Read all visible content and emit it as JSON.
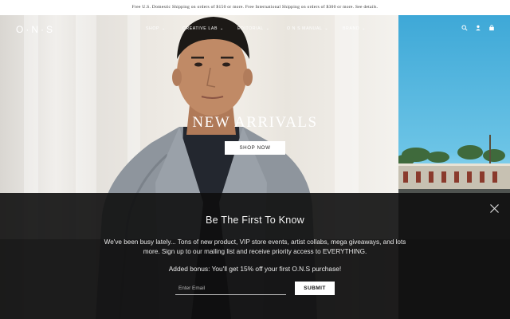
{
  "announcement": "Free U.S. Domestic Shipping on orders of $150 or more. Free International Shipping on orders of $300 or more. See details.",
  "logo": "O·N·S",
  "nav": {
    "items": [
      {
        "label": "SHOP"
      },
      {
        "label": "CREATIVE LAB"
      },
      {
        "label": "EDITORIAL"
      },
      {
        "label": "O N S MANUAL"
      },
      {
        "label": "BRAND"
      }
    ],
    "utility_icons": [
      "search-icon",
      "user-icon",
      "cart-icon"
    ]
  },
  "hero": {
    "title": "NEW ARRIVALS",
    "cta": "SHOP NOW"
  },
  "popup": {
    "title": "Be The First To Know",
    "body": "We've been busy lately... Tons of new product, VIP store events, artist collabs, mega giveaways, and lots more. Sign up to our mailing list and receive priority access to EVERYTHING.",
    "bonus": "Added bonus: You'll get 15% off your first O.N.S purchase!",
    "email_placeholder": "Enter Email",
    "submit": "SUBMIT"
  },
  "colors": {
    "popup_bg": "#0e0e0e",
    "text_light": "#ffffff",
    "sky": "#62bfe4"
  }
}
